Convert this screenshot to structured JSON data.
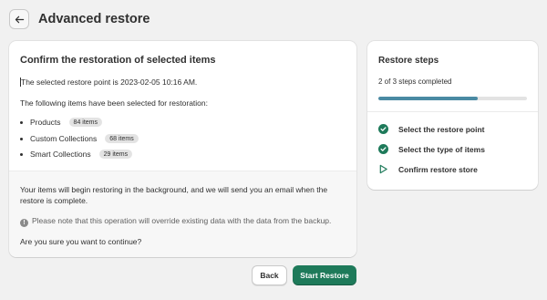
{
  "header": {
    "title": "Advanced restore",
    "back_icon": "arrow-left-icon"
  },
  "main": {
    "heading": "Confirm the restoration of selected items",
    "restore_point_text": "The selected restore point is 2023-02-05 10:16 AM.",
    "items_intro": "The following items have been selected for restoration:",
    "items": [
      {
        "label": "Products",
        "badge": "84 items"
      },
      {
        "label": "Custom Collections",
        "badge": "68 items"
      },
      {
        "label": "Smart Collections",
        "badge": "29 items"
      }
    ],
    "info_line1": "Your items will begin restoring in the background, and we will send you an email when the",
    "info_line2": "restore is complete.",
    "warning_text": "Please note that this operation will override existing data with the data from the backup.",
    "confirm_question": "Are you sure you want to continue?"
  },
  "sidebar": {
    "heading": "Restore steps",
    "progress_text": "2 of 3 steps completed",
    "progress_fraction": 0.667,
    "steps": [
      {
        "label": "Select the restore point",
        "status": "completed",
        "icon": "check-circle-icon"
      },
      {
        "label": "Select the type of items",
        "status": "completed",
        "icon": "check-circle-icon"
      },
      {
        "label": "Confirm restore store",
        "status": "current",
        "icon": "play-outline-icon"
      }
    ]
  },
  "actions": {
    "back_label": "Back",
    "start_label": "Start Restore"
  },
  "colors": {
    "primary": "#1e7a5a",
    "progress": "#4a8aa3",
    "background": "#f1f1f1"
  }
}
